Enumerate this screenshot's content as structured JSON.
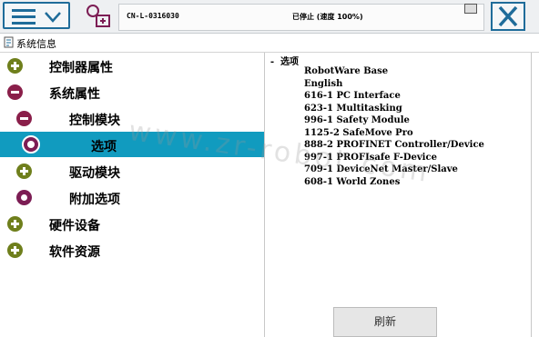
{
  "topbar": {
    "controller_name": "CN-L-0316030",
    "controller_state": "已停止 (速度 100%)"
  },
  "page": {
    "title": "系统信息"
  },
  "tree": {
    "items": [
      {
        "label": "控制器属性",
        "state": "expand"
      },
      {
        "label": "系统属性",
        "state": "collapse"
      },
      {
        "label": "控制模块",
        "state": "collapse"
      },
      {
        "label": "选项",
        "state": "leaf",
        "selected": true
      },
      {
        "label": "驱动模块",
        "state": "expand"
      },
      {
        "label": "附加选项",
        "state": "leaf"
      },
      {
        "label": "硬件设备",
        "state": "expand"
      },
      {
        "label": "软件资源",
        "state": "expand"
      }
    ]
  },
  "options": {
    "header": "- 选项",
    "list": [
      "RobotWare Base",
      "English",
      "616-1 PC Interface",
      "623-1 Multitasking",
      "996-1 Safety Module",
      "1125-2 SafeMove Pro",
      "888-2 PROFINET Controller/Device",
      "997-1 PROFIsafe F-Device",
      "709-1 DeviceNet Master/Slave",
      "608-1 World Zones"
    ]
  },
  "buttons": {
    "refresh": "刷新"
  },
  "watermark": "www.zr-robot.com",
  "colors": {
    "accent": "#1f6c9a",
    "selection": "#119bbf",
    "expand_icon": "#6f7f1c",
    "collapse_icon": "#8a1f4a"
  }
}
